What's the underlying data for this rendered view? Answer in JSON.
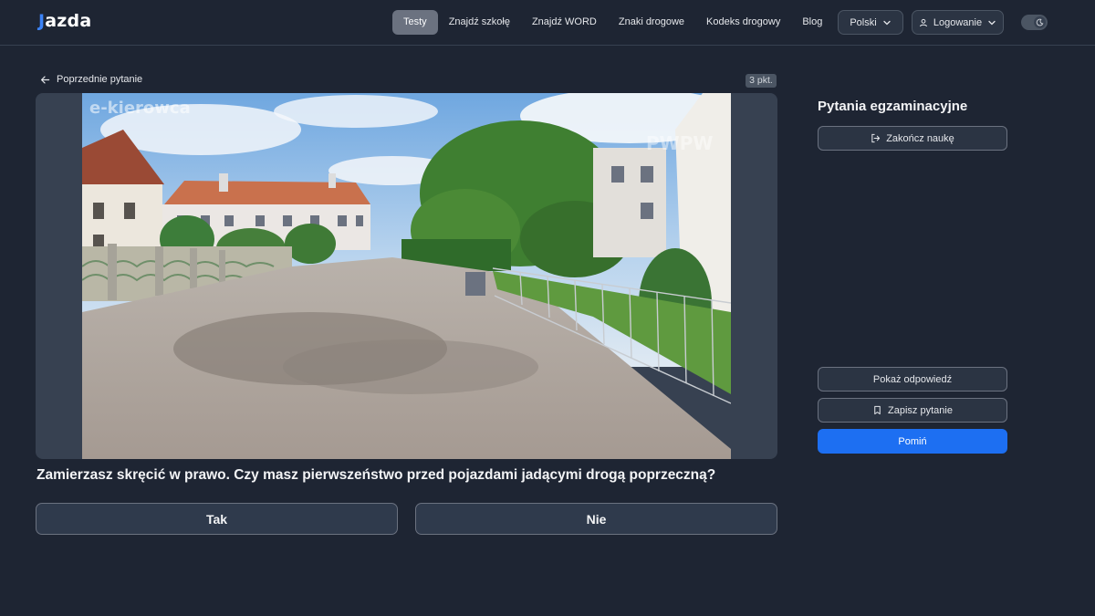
{
  "header": {
    "logo": "jazda",
    "nav": [
      {
        "label": "Testy",
        "active": true
      },
      {
        "label": "Znajdź szkołę",
        "active": false
      },
      {
        "label": "Znajdź WORD",
        "active": false
      },
      {
        "label": "Znaki drogowe",
        "active": false
      },
      {
        "label": "Kodeks drogowy",
        "active": false
      },
      {
        "label": "Blog",
        "active": false
      }
    ],
    "language": "Polski",
    "login": "Logowanie",
    "theme_toggle_icon": "moon-icon"
  },
  "question": {
    "back_label": "Poprzednie pytanie",
    "points": "3 pkt.",
    "text": "Zamierzasz skręcić w prawo. Czy masz pierwszeństwo przed pojazdami jadącymi drogą poprzeczną?",
    "answers": [
      "Tak",
      "Nie"
    ],
    "media": {
      "watermark_left": "e-kierowca",
      "watermark_right": "PWPW"
    }
  },
  "sidebar": {
    "title": "Pytania egzaminacyjne",
    "end_label": "Zakończ naukę",
    "show_answer_label": "Pokaż odpowiedź",
    "save_label": "Zapisz pytanie",
    "skip_label": "Pomiń"
  },
  "colors": {
    "background": "#1e2533",
    "primary": "#1d6ff2",
    "active_nav": "#6b7280"
  }
}
